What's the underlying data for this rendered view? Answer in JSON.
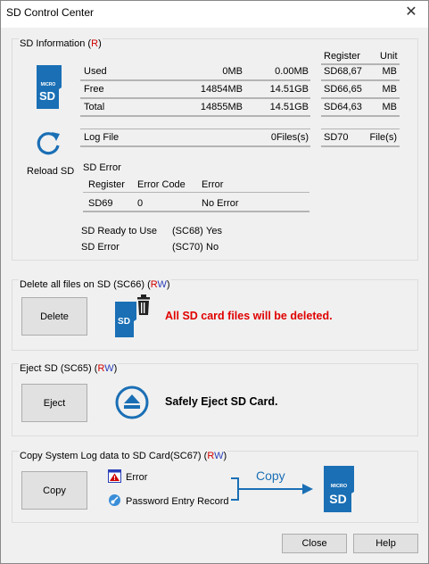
{
  "window": {
    "title": "SD Control Center",
    "close_glyph": "✕"
  },
  "sd_info": {
    "label": "SD Information",
    "access": "R",
    "headers": {
      "register": "Register",
      "unit": "Unit"
    },
    "rows": [
      {
        "name": "Used",
        "value_mb": "0MB",
        "value_gb": "0.00MB",
        "register": "SD68,67",
        "unit": "MB"
      },
      {
        "name": "Free",
        "value_mb": "14854MB",
        "value_gb": "14.51GB",
        "register": "SD66,65",
        "unit": "MB"
      },
      {
        "name": "Total",
        "value_mb": "14855MB",
        "value_gb": "14.51GB",
        "register": "SD64,63",
        "unit": "MB"
      }
    ],
    "log_file": {
      "name": "Log File",
      "value": "0Files(s)",
      "register": "SD70",
      "unit": "File(s)"
    },
    "reload_label": "Reload SD",
    "sd_icon_text": {
      "micro": "MICRO",
      "sd": "SD"
    },
    "error_section": {
      "title": "SD Error",
      "headers": {
        "register": "Register",
        "code": "Error Code",
        "error": "Error"
      },
      "row": {
        "register": "SD69",
        "code": "0",
        "error": "No Error"
      }
    },
    "status": [
      {
        "label": "SD Ready to Use",
        "reg": "(SC68)",
        "value": "Yes"
      },
      {
        "label": "SD Error",
        "reg": "(SC70)",
        "value": "No"
      }
    ]
  },
  "delete_group": {
    "label": "Delete all files on SD (SC66)",
    "access_r": "R",
    "access_w": "W",
    "button": "Delete",
    "message": "All SD card files will be deleted.",
    "icon_text": "SD"
  },
  "eject_group": {
    "label": "Eject SD (SC65)",
    "access_r": "R",
    "access_w": "W",
    "button": "Eject",
    "message": "Safely Eject SD Card."
  },
  "copy_group": {
    "label": "Copy System Log data to SD Card(SC67)",
    "access_r": "R",
    "access_w": "W",
    "button": "Copy",
    "items": [
      "Error",
      "Password Entry Record"
    ],
    "arrow_label": "Copy",
    "sd_icon_text": {
      "micro": "MICRO",
      "sd": "SD"
    }
  },
  "footer": {
    "close": "Close",
    "help": "Help"
  },
  "colors": {
    "sd_blue": "#1a6fb5",
    "warning_red": "#e00000",
    "rw_blue": "#2a3fb8"
  }
}
